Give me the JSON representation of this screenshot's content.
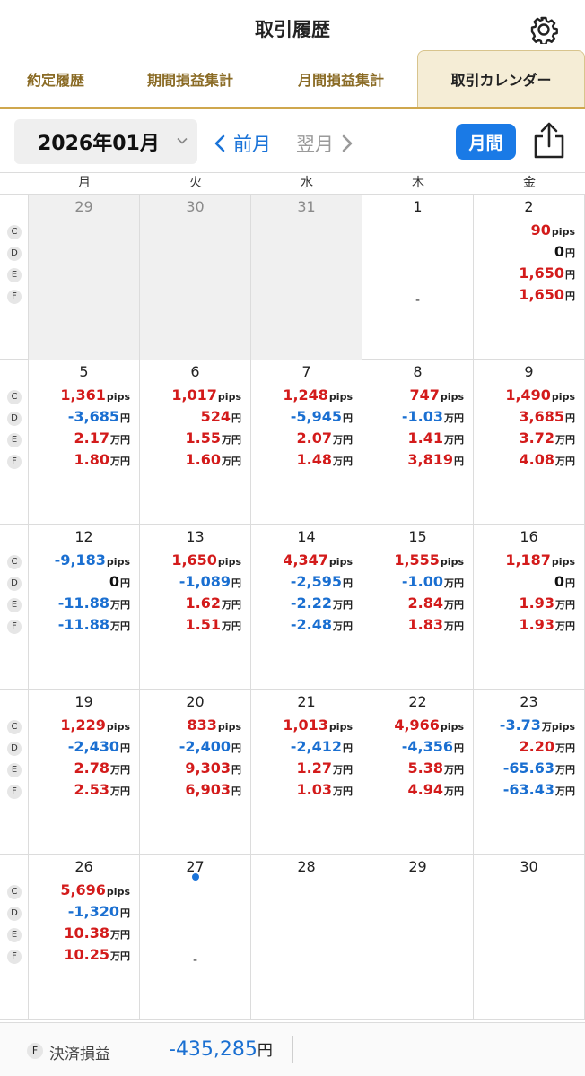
{
  "header": {
    "title": "取引履歴"
  },
  "tabs": [
    {
      "label": "約定履歴",
      "active": false
    },
    {
      "label": "期間損益集計",
      "active": false
    },
    {
      "label": "月間損益集計",
      "active": false
    },
    {
      "label": "取引カレンダー",
      "active": true
    }
  ],
  "toolbar": {
    "month": "2026年01月",
    "prev_label": "前月",
    "next_label": "翌月",
    "monthly_label": "月間"
  },
  "weekdays": [
    "月",
    "火",
    "水",
    "木",
    "金"
  ],
  "row_labels": [
    "C",
    "D",
    "E",
    "F"
  ],
  "weeks": [
    {
      "days": [
        {
          "day": "29",
          "other_month": true,
          "values": []
        },
        {
          "day": "30",
          "other_month": true,
          "values": []
        },
        {
          "day": "31",
          "other_month": true,
          "values": []
        },
        {
          "day": "1",
          "values": [],
          "dash": "-"
        },
        {
          "day": "2",
          "values": [
            {
              "num": "90",
              "unit": "pips",
              "sign": "pos"
            },
            {
              "num": "0",
              "unit": "円",
              "sign": "zero"
            },
            {
              "num": "1,650",
              "unit": "円",
              "sign": "pos"
            },
            {
              "num": "1,650",
              "unit": "円",
              "sign": "pos"
            }
          ]
        }
      ]
    },
    {
      "days": [
        {
          "day": "5",
          "values": [
            {
              "num": "1,361",
              "unit": "pips",
              "sign": "pos"
            },
            {
              "num": "-3,685",
              "unit": "円",
              "sign": "neg"
            },
            {
              "num": "2.17",
              "unit": "万円",
              "sign": "pos"
            },
            {
              "num": "1.80",
              "unit": "万円",
              "sign": "pos"
            }
          ]
        },
        {
          "day": "6",
          "values": [
            {
              "num": "1,017",
              "unit": "pips",
              "sign": "pos"
            },
            {
              "num": "524",
              "unit": "円",
              "sign": "pos"
            },
            {
              "num": "1.55",
              "unit": "万円",
              "sign": "pos"
            },
            {
              "num": "1.60",
              "unit": "万円",
              "sign": "pos"
            }
          ]
        },
        {
          "day": "7",
          "values": [
            {
              "num": "1,248",
              "unit": "pips",
              "sign": "pos"
            },
            {
              "num": "-5,945",
              "unit": "円",
              "sign": "neg"
            },
            {
              "num": "2.07",
              "unit": "万円",
              "sign": "pos"
            },
            {
              "num": "1.48",
              "unit": "万円",
              "sign": "pos"
            }
          ]
        },
        {
          "day": "8",
          "values": [
            {
              "num": "747",
              "unit": "pips",
              "sign": "pos"
            },
            {
              "num": "-1.03",
              "unit": "万円",
              "sign": "neg"
            },
            {
              "num": "1.41",
              "unit": "万円",
              "sign": "pos"
            },
            {
              "num": "3,819",
              "unit": "円",
              "sign": "pos"
            }
          ]
        },
        {
          "day": "9",
          "values": [
            {
              "num": "1,490",
              "unit": "pips",
              "sign": "pos"
            },
            {
              "num": "3,685",
              "unit": "円",
              "sign": "pos"
            },
            {
              "num": "3.72",
              "unit": "万円",
              "sign": "pos"
            },
            {
              "num": "4.08",
              "unit": "万円",
              "sign": "pos"
            }
          ]
        }
      ]
    },
    {
      "days": [
        {
          "day": "12",
          "values": [
            {
              "num": "-9,183",
              "unit": "pips",
              "sign": "neg"
            },
            {
              "num": "0",
              "unit": "円",
              "sign": "zero"
            },
            {
              "num": "-11.88",
              "unit": "万円",
              "sign": "neg"
            },
            {
              "num": "-11.88",
              "unit": "万円",
              "sign": "neg"
            }
          ]
        },
        {
          "day": "13",
          "values": [
            {
              "num": "1,650",
              "unit": "pips",
              "sign": "pos"
            },
            {
              "num": "-1,089",
              "unit": "円",
              "sign": "neg"
            },
            {
              "num": "1.62",
              "unit": "万円",
              "sign": "pos"
            },
            {
              "num": "1.51",
              "unit": "万円",
              "sign": "pos"
            }
          ]
        },
        {
          "day": "14",
          "values": [
            {
              "num": "4,347",
              "unit": "pips",
              "sign": "pos"
            },
            {
              "num": "-2,595",
              "unit": "円",
              "sign": "neg"
            },
            {
              "num": "-2.22",
              "unit": "万円",
              "sign": "neg"
            },
            {
              "num": "-2.48",
              "unit": "万円",
              "sign": "neg"
            }
          ]
        },
        {
          "day": "15",
          "values": [
            {
              "num": "1,555",
              "unit": "pips",
              "sign": "pos"
            },
            {
              "num": "-1.00",
              "unit": "万円",
              "sign": "neg"
            },
            {
              "num": "2.84",
              "unit": "万円",
              "sign": "pos"
            },
            {
              "num": "1.83",
              "unit": "万円",
              "sign": "pos"
            }
          ]
        },
        {
          "day": "16",
          "values": [
            {
              "num": "1,187",
              "unit": "pips",
              "sign": "pos"
            },
            {
              "num": "0",
              "unit": "円",
              "sign": "zero"
            },
            {
              "num": "1.93",
              "unit": "万円",
              "sign": "pos"
            },
            {
              "num": "1.93",
              "unit": "万円",
              "sign": "pos"
            }
          ]
        }
      ]
    },
    {
      "days": [
        {
          "day": "19",
          "values": [
            {
              "num": "1,229",
              "unit": "pips",
              "sign": "pos"
            },
            {
              "num": "-2,430",
              "unit": "円",
              "sign": "neg"
            },
            {
              "num": "2.78",
              "unit": "万円",
              "sign": "pos"
            },
            {
              "num": "2.53",
              "unit": "万円",
              "sign": "pos"
            }
          ]
        },
        {
          "day": "20",
          "values": [
            {
              "num": "833",
              "unit": "pips",
              "sign": "pos"
            },
            {
              "num": "-2,400",
              "unit": "円",
              "sign": "neg"
            },
            {
              "num": "9,303",
              "unit": "円",
              "sign": "pos"
            },
            {
              "num": "6,903",
              "unit": "円",
              "sign": "pos"
            }
          ]
        },
        {
          "day": "21",
          "values": [
            {
              "num": "1,013",
              "unit": "pips",
              "sign": "pos"
            },
            {
              "num": "-2,412",
              "unit": "円",
              "sign": "neg"
            },
            {
              "num": "1.27",
              "unit": "万円",
              "sign": "pos"
            },
            {
              "num": "1.03",
              "unit": "万円",
              "sign": "pos"
            }
          ]
        },
        {
          "day": "22",
          "values": [
            {
              "num": "4,966",
              "unit": "pips",
              "sign": "pos"
            },
            {
              "num": "-4,356",
              "unit": "円",
              "sign": "neg"
            },
            {
              "num": "5.38",
              "unit": "万円",
              "sign": "pos"
            },
            {
              "num": "4.94",
              "unit": "万円",
              "sign": "pos"
            }
          ]
        },
        {
          "day": "23",
          "values": [
            {
              "num": "-3.73",
              "unit": "万pips",
              "sign": "neg"
            },
            {
              "num": "2.20",
              "unit": "万円",
              "sign": "pos"
            },
            {
              "num": "-65.63",
              "unit": "万円",
              "sign": "neg"
            },
            {
              "num": "-63.43",
              "unit": "万円",
              "sign": "neg"
            }
          ]
        }
      ]
    },
    {
      "days": [
        {
          "day": "26",
          "values": [
            {
              "num": "5,696",
              "unit": "pips",
              "sign": "pos"
            },
            {
              "num": "-1,320",
              "unit": "円",
              "sign": "neg"
            },
            {
              "num": "10.38",
              "unit": "万円",
              "sign": "pos"
            },
            {
              "num": "10.25",
              "unit": "万円",
              "sign": "pos"
            }
          ]
        },
        {
          "day": "27",
          "values": [],
          "dash": "-",
          "today": true
        },
        {
          "day": "28",
          "values": []
        },
        {
          "day": "29",
          "values": []
        },
        {
          "day": "30",
          "values": []
        }
      ]
    }
  ],
  "footer": {
    "badge": "F",
    "label": "決済損益",
    "value": "-435,285",
    "unit": "円"
  },
  "colors": {
    "positive": "#d31b1b",
    "negative": "#1a6fd1",
    "accent_gold": "#cfa74d",
    "primary_blue": "#1a7ae6"
  }
}
